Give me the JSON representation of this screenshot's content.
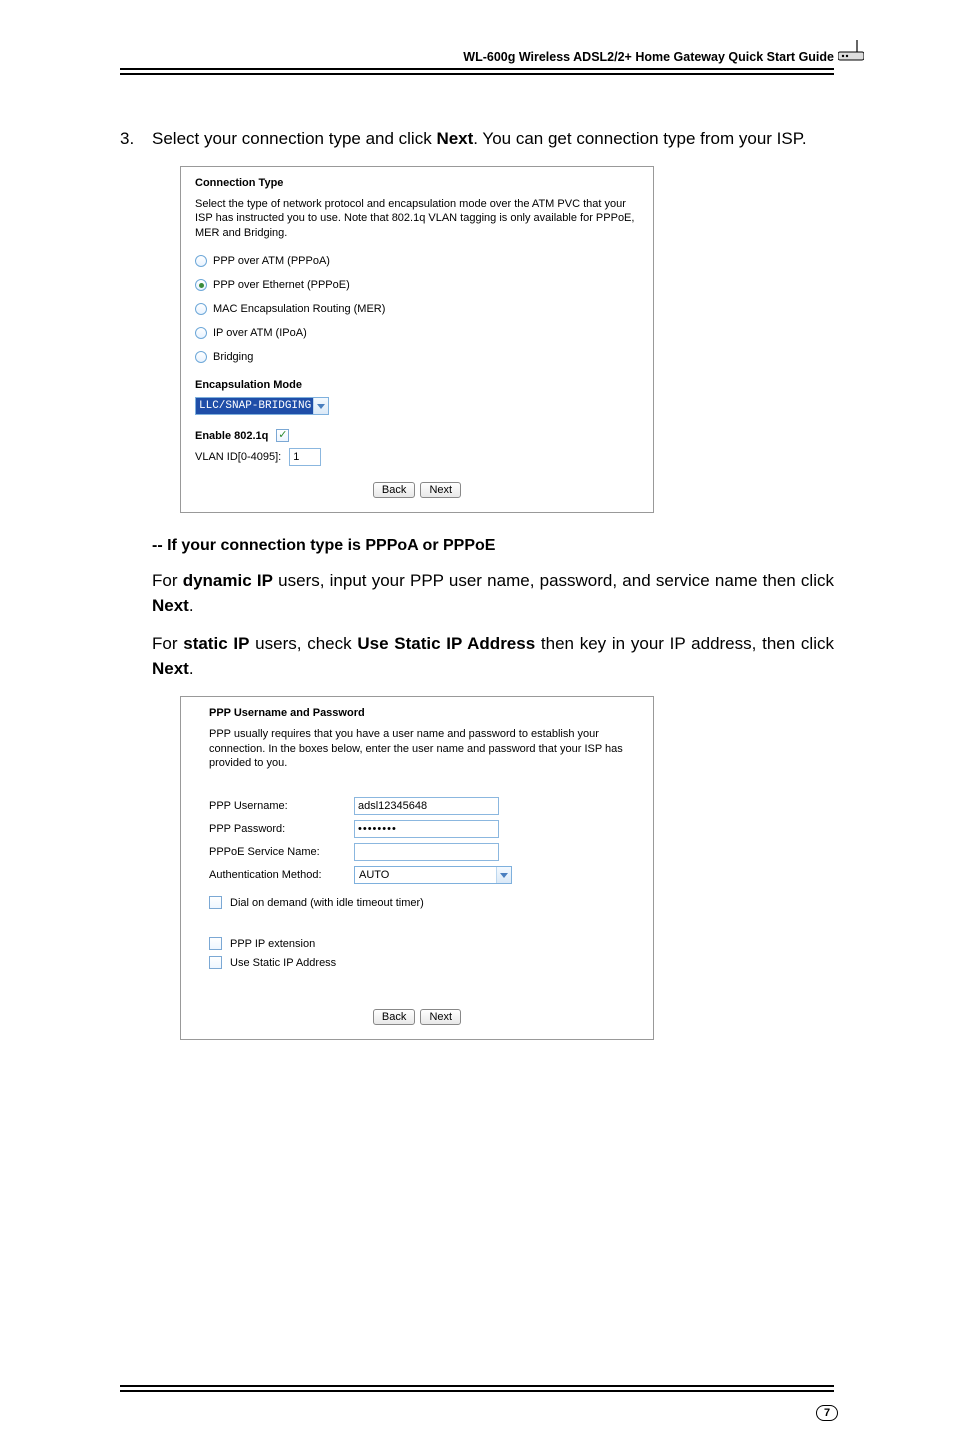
{
  "header": {
    "title": "WL-600g Wireless ADSL2/2+ Home Gateway Quick Start Guide"
  },
  "step3": {
    "num": "3.",
    "text_before_bold": "Select your connection type and click ",
    "bold1": "Next",
    "text_after_bold": ". You can get connection type from your ISP."
  },
  "panel1": {
    "title": "Connection Type",
    "desc": "Select the type of network protocol and encapsulation mode over the ATM PVC that your ISP has instructed you to use. Note that 802.1q VLAN tagging is only available for PPPoE, MER and Bridging.",
    "radios": {
      "pppoa": "PPP over ATM (PPPoA)",
      "pppoe": "PPP over Ethernet (PPPoE)",
      "mer": "MAC Encapsulation Routing (MER)",
      "ipoa": "IP over ATM (IPoA)",
      "bridging": "Bridging"
    },
    "encap_label": "Encapsulation Mode",
    "encap_value": "LLC/SNAP-BRIDGING",
    "enable_label": "Enable 802.1q",
    "vlan_label": "VLAN ID[0-4095]:",
    "vlan_value": "1",
    "back_btn": "Back",
    "next_btn": "Next"
  },
  "subsection": {
    "heading": "-- If your connection type is PPPoA or PPPoE",
    "para1_a": "For ",
    "para1_b": "dynamic IP",
    "para1_c": " users, input your PPP user name, password, and service name then click ",
    "para1_d": "Next",
    "para1_e": ".",
    "para2_a": "For ",
    "para2_b": "static IP",
    "para2_c": " users, check ",
    "para2_d": "Use Static IP Address",
    "para2_e": " then key in your IP address, then click ",
    "para2_f": "Next",
    "para2_g": "."
  },
  "panel2": {
    "title": "PPP Username and Password",
    "desc": "PPP usually requires that you have a user name and password to establish your connection. In the boxes below, enter the user name and password that your ISP has provided to you.",
    "username_label": "PPP Username:",
    "username_value": "adsl12345648",
    "password_label": "PPP Password:",
    "password_value": "••••••••",
    "service_label": "PPPoE Service Name:",
    "service_value": "",
    "auth_label": "Authentication Method:",
    "auth_value": "AUTO",
    "dod_label": "Dial on demand (with idle timeout timer)",
    "pppipext_label": "PPP IP extension",
    "staticip_label": "Use Static IP Address",
    "back_btn": "Back",
    "next_btn": "Next"
  },
  "footer": {
    "page": "7"
  }
}
